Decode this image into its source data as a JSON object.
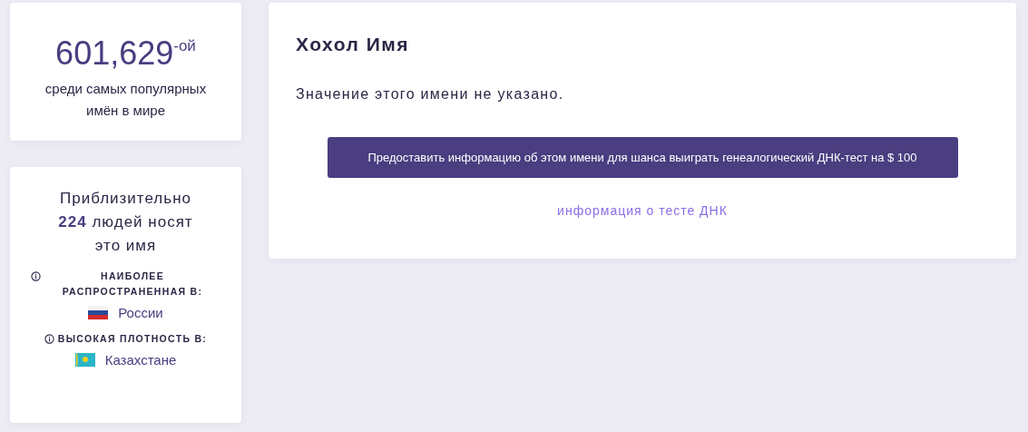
{
  "rank_card": {
    "rank": "601,629$^{-ой}$",
    "caption": "среди самых популярных имён в мире"
  },
  "people_card": {
    "estimate": "Приблизительно **224** людей носят это имя",
    "sections": [
      {
        "label": "НАИБОЛЕЕ РАСПРОСТРАНЕННАЯ В:",
        "country": "России",
        "kind": "russia"
      },
      {
        "label": "ВЫСОКАЯ ПЛОТНОСТЬ В:",
        "country": "Казахстане",
        "kind": "kazakhstan"
      }
    ]
  },
  "main": {
    "title": "Хохол Имя",
    "meaning": "Значение этого имени не указано.",
    "button": "Предоставить информацию об этом имени для шанса выиграть генеалогический ДНК-тест на $ 100",
    "link": "информация о тесте ДНК"
  }
}
